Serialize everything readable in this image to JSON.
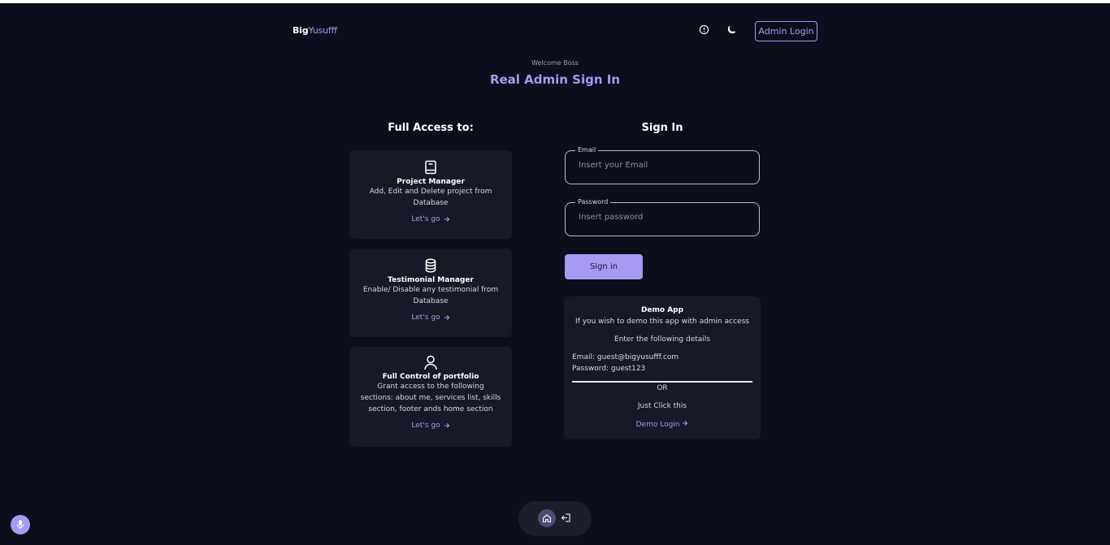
{
  "header": {
    "logo_part1": "Big",
    "logo_part2": "Yusufff",
    "admin_login_label": "Admin Login",
    "icons": [
      "info-icon",
      "moon-icon"
    ]
  },
  "hero": {
    "welcome": "Welcome Boss",
    "title": "Real Admin Sign In"
  },
  "access": {
    "title": "Full Access to:",
    "cards": [
      {
        "icon": "book-icon",
        "title": "Project Manager",
        "desc_lines": [
          "Add, Edit and Delete project from",
          "Database"
        ],
        "link": "Let's go"
      },
      {
        "icon": "database-icon",
        "title": "Testimonial Manager",
        "desc_lines": [
          "Enable/ Disable any testimonial from",
          "Database"
        ],
        "link": "Let's go"
      },
      {
        "icon": "user-icon",
        "title": "Full Control of portfolio",
        "desc_lines": [
          "Grant access to the following",
          "sections: about me, services list, skills",
          "section, footer ands home section"
        ],
        "link": "Let's go"
      }
    ]
  },
  "signin": {
    "title": "Sign In",
    "email_label": "Email",
    "email_placeholder": "Insert your Email",
    "email_value": "",
    "password_label": "Password",
    "password_placeholder": "Insert password",
    "password_value": "",
    "button_label": "Sign in"
  },
  "demo": {
    "title": "Demo App",
    "line1": "If you wish to demo this app with admin access",
    "line2": "Enter the following details",
    "email_line": "Email: guest@bigyusufff.com",
    "password_line": "Password: guest123",
    "or": "OR",
    "click_this": "Just Click this",
    "link": "Demo Login"
  },
  "bottom_nav": {
    "icons": [
      "home-icon",
      "logout-icon"
    ]
  },
  "colors": {
    "background": "#0b0f1b",
    "accent": "#a79af2",
    "card": "#161a26"
  }
}
